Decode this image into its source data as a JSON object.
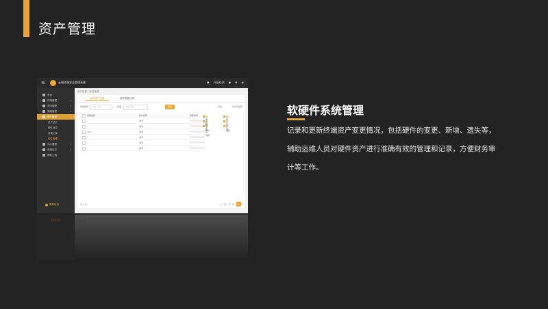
{
  "page": {
    "title": "资产管理"
  },
  "screenshot": {
    "app_title": "云端终端安全管理系统",
    "topbar_icons": [
      "menu-icon",
      "user-icon",
      "bell-icon",
      "gear-icon",
      "account-icon"
    ],
    "topbar_labels": [
      "升级检测"
    ],
    "breadcrumb": "资产管理 / 软件管理",
    "sidebar": {
      "items": [
        {
          "label": "首页"
        },
        {
          "label": "终端管理"
        },
        {
          "label": "安全管理"
        },
        {
          "label": "策略管理"
        },
        {
          "label": "资产管理"
        },
        {
          "label": "资产统计"
        },
        {
          "label": "硬件信息"
        },
        {
          "label": "变更记录"
        },
        {
          "label": "软件管理"
        },
        {
          "label": "中心管理"
        },
        {
          "label": "系统日志"
        },
        {
          "label": "帮助工具"
        }
      ],
      "footer": "更新检测"
    },
    "tabs": [
      "软件资产列表",
      "软件变更记录"
    ],
    "filters": {
      "label1": "终端名称",
      "placeholder1": "请输入名称",
      "label2": "类型",
      "placeholder2": "请选择类型",
      "button": "查询",
      "right1": "导出",
      "right2": "显示列设置"
    },
    "table": {
      "headers": [
        "终端名称",
        "软件名称",
        "安装时间"
      ],
      "rows": [
        {
          "name": "-",
          "software": "通讯"
        },
        {
          "name": "-",
          "software": "通讯"
        },
        {
          "name": "123",
          "software": "通讯"
        },
        {
          "name": "-",
          "software": "通讯"
        },
        {
          "name": "-",
          "software": "通讯"
        },
        {
          "name": "-",
          "software": "通讯"
        }
      ]
    },
    "column_panel": [
      [
        "终端名称",
        "版本"
      ],
      [
        "终端分组",
        "安装"
      ],
      [
        "软件名",
        "卸载"
      ],
      [
        "CPU",
        "更新"
      ],
      [
        "内存",
        ""
      ]
    ],
    "pager": {
      "total": "共 1 条",
      "prev": "上一页",
      "next": "下一页",
      "current": "1"
    }
  },
  "section": {
    "title": "软硬件系统管理",
    "description": "记录和更新终端资产变更情况，包括硬件的变更、新增、遗失等，辅助运维人员对硬件资产进行准确有效的管理和记录，方便财务审计等工作。"
  },
  "colors": {
    "accent": "#e8a33d",
    "background": "#232323"
  }
}
